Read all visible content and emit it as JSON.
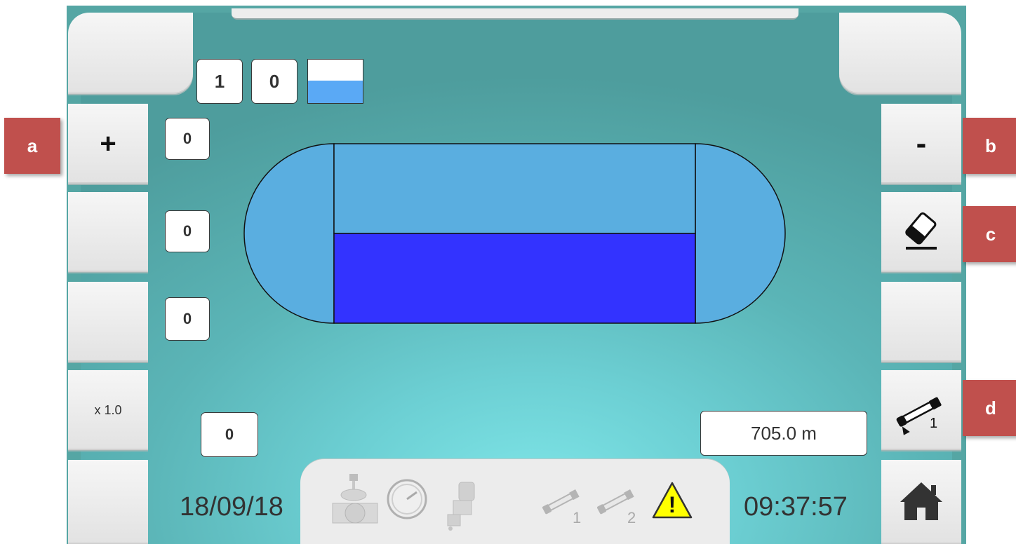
{
  "top_indicators": {
    "digit_1": "1",
    "digit_2": "0"
  },
  "left_buttons": {
    "plus_label": "+",
    "scale_label": "x 1.0"
  },
  "right_buttons": {
    "minus_label": "-",
    "nozzle_number": "1"
  },
  "counters": [
    "0",
    "0",
    "0",
    "0"
  ],
  "tank": {
    "fill_fraction": 0.5,
    "colors": {
      "upper": "#5aaee0",
      "lower": "#3333ff"
    }
  },
  "distance": "705.0 m",
  "status_bar": {
    "date": "18/09/18",
    "time": "09:37:57",
    "nozzle_1": "1",
    "nozzle_2": "2",
    "warning_symbol": "!"
  },
  "annotations": {
    "a": "a",
    "b": "b",
    "c": "c",
    "d": "d"
  },
  "icons": [
    "eraser-icon",
    "spray-nozzle-icon",
    "home-icon",
    "valve-icon",
    "pressure-gauge-icon",
    "pump-icon",
    "warning-icon"
  ],
  "colors": {
    "screen": "#5bb5b7",
    "button": "#ececec",
    "annotation": "#c0504d"
  }
}
